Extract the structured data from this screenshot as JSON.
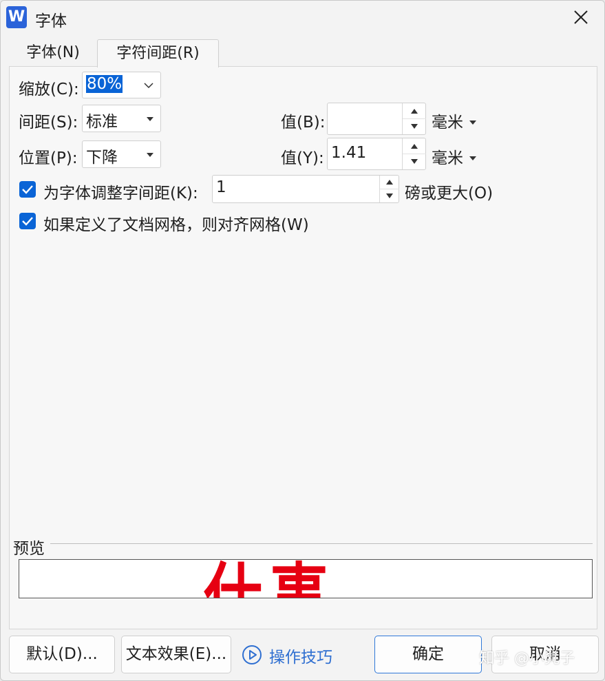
{
  "window": {
    "title": "字体",
    "app_icon_letter": "W"
  },
  "tabs": [
    {
      "label": "字体(N)",
      "active": false
    },
    {
      "label": "字符间距(R)",
      "active": true
    }
  ],
  "scale": {
    "label": "缩放(C):",
    "value": "80%"
  },
  "spacing": {
    "label": "间距(S):",
    "value": "标准"
  },
  "position": {
    "label": "位置(P):",
    "value": "下降"
  },
  "spacing_amount": {
    "label": "值(B):",
    "value": "",
    "unit": "毫米"
  },
  "position_amount": {
    "label": "值(Y):",
    "value": "1.41",
    "unit": "毫米"
  },
  "kerning": {
    "label": "为字体调整字间距(K):",
    "value": "1",
    "suffix": "磅或更大(O)",
    "checked": true
  },
  "grid_snap": {
    "label": "如果定义了文档网格，则对齐网格(W)",
    "checked": true
  },
  "preview": {
    "label": "预览",
    "sample_text": "仕事",
    "sample_color": "#e60012"
  },
  "buttons": {
    "default": "默认(D)...",
    "text_effects": "文本效果(E)...",
    "tips": "操作技巧",
    "ok": "确定",
    "cancel": "取消"
  },
  "watermark": "知乎 @小凳子",
  "colors": {
    "accent": "#0a64d6",
    "link": "#2f6fd1"
  }
}
